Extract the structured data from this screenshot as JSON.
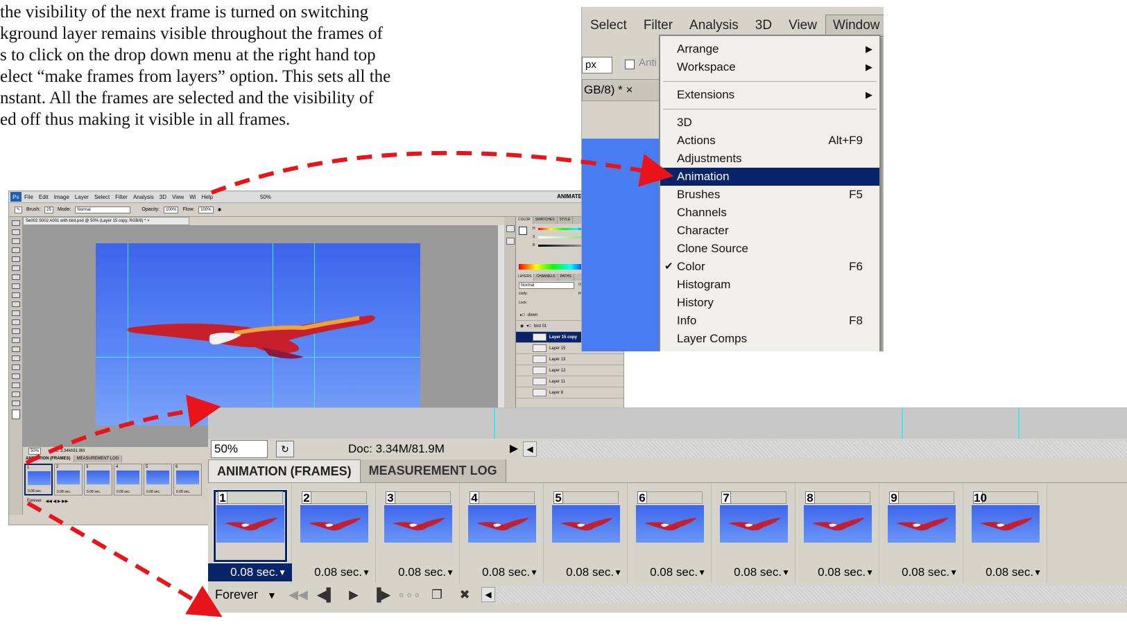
{
  "document": {
    "lines": [
      "the visibility of the next frame is turned on switching",
      "kground layer remains visible throughout the frames of",
      "s to click on the drop down menu at the right hand top",
      "elect “make frames from layers” option. This sets all the",
      "nstant. All the frames are selected and the visibility of",
      "ed off thus making it visible in all frames."
    ]
  },
  "ps_small": {
    "logo": "Ps",
    "menu": [
      "File",
      "Edit",
      "Image",
      "Layer",
      "Select",
      "Filter",
      "Analysis",
      "3D",
      "View",
      "Wi",
      "Help"
    ],
    "zoom": "50%",
    "workspace": "ANIMATE",
    "brush_label": "Brush:",
    "brush_size": "25",
    "mode_label": "Mode:",
    "mode_value": "Normal",
    "opacity_label": "Opacity:",
    "opacity_value": "100%",
    "flow_label": "Flow:",
    "flow_value": "100%",
    "doc_tab": "Se002 S002 A001 with bird.psd @ 50% (Layer 15 copy, RGB/8) * ×",
    "color_tabs": [
      "COLOR",
      "SWATCHES",
      "STYLE"
    ],
    "color_channels": [
      "H",
      "S",
      "B"
    ],
    "layers_tabs": [
      "LAYERS",
      "CHANNELS",
      "PATHS"
    ],
    "blend_mode": "Normal",
    "opacity_short": "Op",
    "unify_label": "Unify:",
    "propagate_label": "Pr",
    "lock_label": "Lock:",
    "layers": [
      "down",
      "bird 01",
      "Layer 15 copy",
      "Layer 15",
      "Layer 13",
      "Layer 12",
      "Layer 11",
      "Layer 8"
    ],
    "status_zoom": "50%",
    "status_doc": "Doc: 3.34M/81.9M",
    "anim_tabs": [
      "ANIMATION (FRAMES)",
      "MEASUREMENT LOG"
    ],
    "frame_numbers": [
      "1",
      "2",
      "3",
      "4",
      "5",
      "6"
    ],
    "frame_delay": "0.08 sec.",
    "loop": "Forever"
  },
  "window_menu": {
    "menubar": [
      "Select",
      "Filter",
      "Analysis",
      "3D",
      "View",
      "Window"
    ],
    "active_menu": "Window",
    "size_value": "px",
    "anti_alias": "Anti",
    "doc_tab": "GB/8) * ×",
    "doc_tab2": "0",
    "groups": [
      [
        {
          "label": "Arrange",
          "submenu": true
        },
        {
          "label": "Workspace",
          "submenu": true
        }
      ],
      [
        {
          "label": "Extensions",
          "submenu": true
        }
      ],
      [
        {
          "label": "3D"
        },
        {
          "label": "Actions",
          "shortcut": "Alt+F9"
        },
        {
          "label": "Adjustments"
        },
        {
          "label": "Animation",
          "highlighted": true
        },
        {
          "label": "Brushes",
          "shortcut": "F5"
        },
        {
          "label": "Channels"
        },
        {
          "label": "Character"
        },
        {
          "label": "Clone Source"
        },
        {
          "label": "Color",
          "shortcut": "F6",
          "checked": true
        },
        {
          "label": "Histogram"
        },
        {
          "label": "History"
        },
        {
          "label": "Info",
          "shortcut": "F8"
        },
        {
          "label": "Layer Comps"
        }
      ]
    ],
    "submenu_glyph": "▶",
    "check_glyph": "✔"
  },
  "animation_panel": {
    "zoom": "50%",
    "doc_size": "Doc: 3.34M/81.9M",
    "tabs": [
      "ANIMATION (FRAMES)",
      "MEASUREMENT LOG"
    ],
    "active_tab": "ANIMATION (FRAMES)",
    "frames": [
      {
        "number": "1",
        "delay": "0.08 sec.",
        "selected": true
      },
      {
        "number": "2",
        "delay": "0.08 sec."
      },
      {
        "number": "3",
        "delay": "0.08 sec."
      },
      {
        "number": "4",
        "delay": "0.08 sec."
      },
      {
        "number": "5",
        "delay": "0.08 sec."
      },
      {
        "number": "6",
        "delay": "0.08 sec."
      },
      {
        "number": "7",
        "delay": "0.08 sec."
      },
      {
        "number": "8",
        "delay": "0.08 sec."
      },
      {
        "number": "9",
        "delay": "0.08 sec."
      },
      {
        "number": "10",
        "delay": "0.08 sec."
      }
    ],
    "delay_dropdown_glyph": "▼",
    "loop_option": "Forever",
    "controls": [
      {
        "name": "first-frame-button",
        "glyph": "◀◀"
      },
      {
        "name": "previous-frame-button",
        "glyph": "◀▌"
      },
      {
        "name": "play-button",
        "glyph": "▶"
      },
      {
        "name": "next-frame-button",
        "glyph": "▐▶"
      },
      {
        "name": "tween-button",
        "glyph": "∘∘∘"
      },
      {
        "name": "duplicate-frame-button",
        "glyph": "❐"
      },
      {
        "name": "delete-frame-button",
        "glyph": "✖"
      }
    ]
  },
  "colors": {
    "highlight": "#0a246a",
    "arrow": "#e8141a",
    "canvas_blue": "#4a7cf1",
    "guide": "#47e6f0"
  }
}
